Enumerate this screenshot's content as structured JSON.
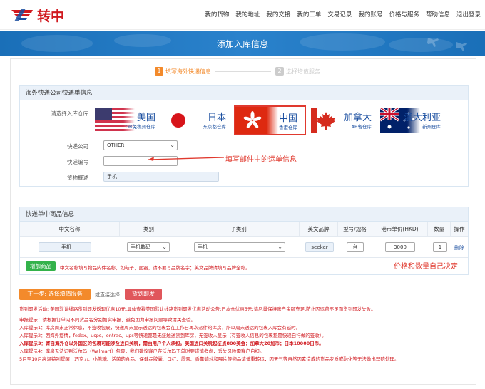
{
  "brand": {
    "name": "转中"
  },
  "nav": [
    "我的货物",
    "我的地址",
    "我的交接",
    "我的工单",
    "交易记录",
    "我的账号",
    "价格与服务",
    "帮助信息",
    "退出登录"
  ],
  "banner": {
    "title": "添加入库信息"
  },
  "steps": [
    {
      "num": "1",
      "label": "填写海外快递信息",
      "active": true
    },
    {
      "num": "2",
      "label": "选择增值服务",
      "active": false
    }
  ],
  "express_section": {
    "title": "海外快递公司快递单信息",
    "warehouse_label": "请选择入库仓库",
    "warehouses": [
      {
        "name": "美国",
        "sub": "OR免税州仓库",
        "flag": "us-flag-icon"
      },
      {
        "name": "日本",
        "sub": "东京都仓库",
        "flag": "japan-flag-icon"
      },
      {
        "name": "中国",
        "sub": "香港仓库",
        "flag": "hongkong-flag-icon",
        "selected": true
      },
      {
        "name": "加拿大",
        "sub": "AB省仓库",
        "flag": "canada-flag-icon"
      },
      {
        "name": "澳大利亚",
        "sub": "新州仓库",
        "flag": "australia-flag-icon"
      }
    ],
    "company_label": "快递公司",
    "company_value": "OTHER",
    "tracking_label": "快递编号",
    "tracking_value": "",
    "goods_label": "货物概述",
    "goods_value": "手机"
  },
  "annotations": {
    "tracking_hint": "填写邮件中的运单信息",
    "price_hint": "价格和数量自己决定"
  },
  "items_section": {
    "title": "快递单中商品信息",
    "columns": [
      "中文名称",
      "类别",
      "子类别",
      "英文品牌",
      "型号/规格",
      "港币单价(HKD)",
      "数量",
      "操作"
    ],
    "row": {
      "cn_name": "手机",
      "category": "手机数码",
      "subcategory": "手机",
      "brand": "seeker",
      "model": "台",
      "price": "3000",
      "qty": "1",
      "action": "删除"
    },
    "add_button": "增加商品",
    "add_note": "中文名称填写物品内件名称，如鞋子，面霜，请不要写品牌名字；英文品牌请填写品牌全称。"
  },
  "actions": {
    "next_button": "下一步: 选择增值服务",
    "or_text": "或直接选择",
    "direct_button": "货到即发"
  },
  "notices": {
    "promo": "货到即发活动: 美国默认线路货到即发返现优惠10元,具体查看美国默认线路货到即发优惠活动公告;日本仓优惠5元;请尽量保持账户金额充足,防止因运费不足而货到即发失败。",
    "lines": [
      {
        "text": "申报提示：请根据订单内不同货品名分别如实申报，避免因为申报问题导致清关查验。",
        "color": "#d0191f",
        "bold": false
      },
      {
        "text": "入库提示1：库房周末正常休息，不签收包裹，快递周末显示送达的包裹会在工作日再次派件给库房，所以周末送达的包裹入库会有延时。",
        "color": "#d0191f",
        "bold": false
      },
      {
        "text": "入库提示2：因海外疫情，fedex、usps、ontrac、ups等快递都是无接触送货到库房，无签收人显示（有签收人信息的包裹都是快递自行做的签收）。",
        "color": "#d0191f",
        "bold": false
      },
      {
        "text": "入库提示3：寄自海外仓以外国区的包裹可能涉及进口关税，需由用户个人承担。美国进口关税起征点800美金；加拿大20加币；日本10000日币。",
        "color": "#d0191f",
        "bold": true
      },
      {
        "text": "入库提示4：库房无法识别沃尔玛（Walmart）包裹，我们建议客户在沃尔玛下单时要谨慎考虑，丢失风险需客户自担。",
        "color": "#d0191f",
        "bold": false
      },
      {
        "text": "5月至10月高温特别提醒：巧克力、小熊糖、活菌的食品、保健品胶囊、口红、唇膏、香薰蜡烛和喂片等物品请慎重转运，因天气等自然因素造成的货品变质或融化等无法做出理赔处理。",
        "color": "#d0191f",
        "bold": false
      }
    ]
  },
  "colors": {
    "brand_red": "#d0191f",
    "banner_blue": "#1f74bf",
    "orange": "#f38a2b",
    "green": "#33b24a"
  }
}
